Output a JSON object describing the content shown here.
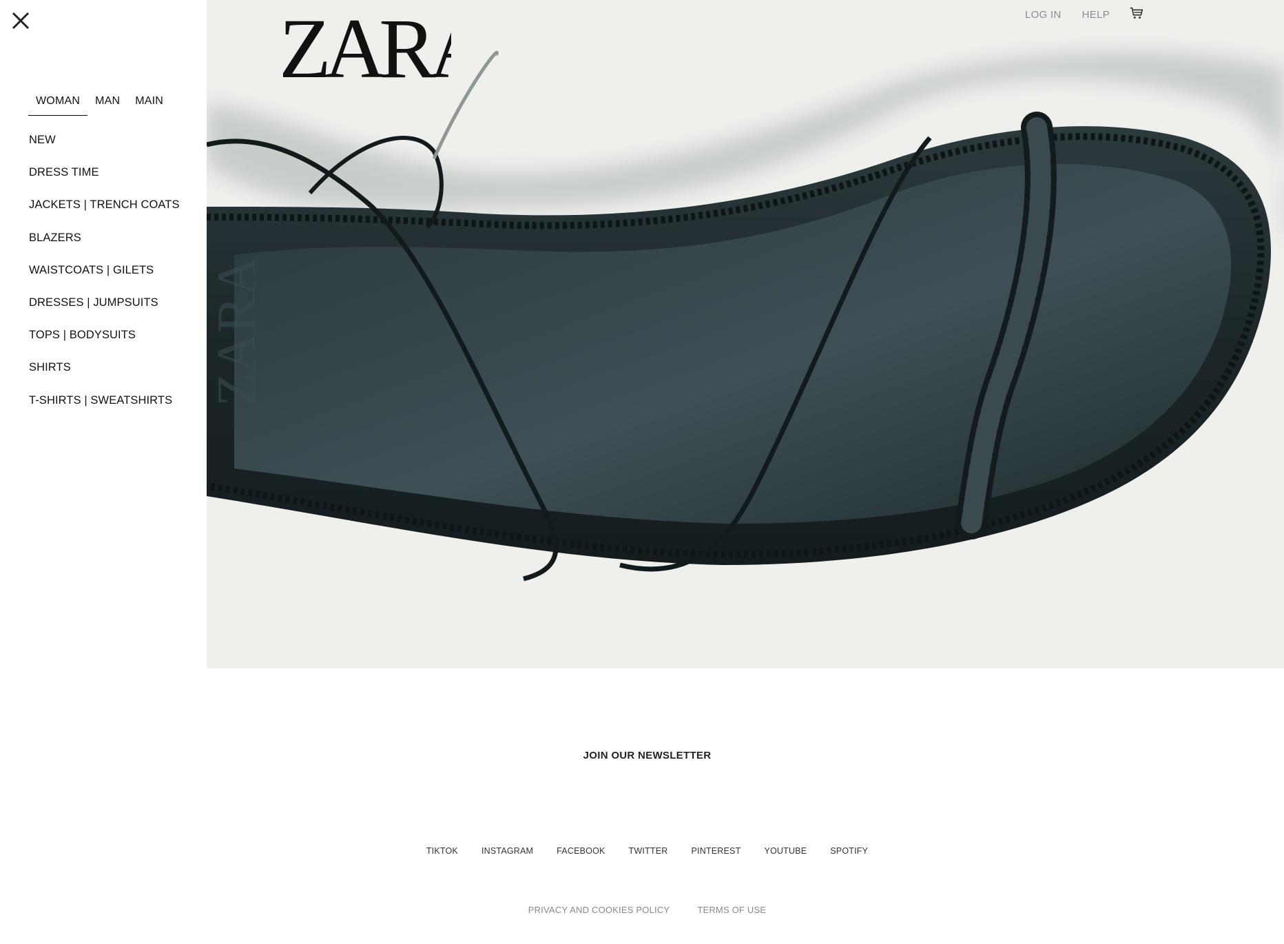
{
  "brand": {
    "logo_text": "ZARA"
  },
  "sidebar": {
    "close_icon": "close-icon",
    "tabs": [
      {
        "label": "WOMAN",
        "active": true
      },
      {
        "label": "MAN",
        "active": false
      },
      {
        "label": "MAIN",
        "active": false
      }
    ],
    "items": [
      {
        "label": "NEW"
      },
      {
        "label": "DRESS TIME"
      },
      {
        "label": "JACKETS | TRENCH COATS"
      },
      {
        "label": "BLAZERS"
      },
      {
        "label": "WAISTCOATS | GILETS"
      },
      {
        "label": "DRESSES | JUMPSUITS"
      },
      {
        "label": "TOPS | BODYSUITS"
      },
      {
        "label": "SHIRTS"
      },
      {
        "label": "T-SHIRTS | SWEATSHIRTS"
      }
    ]
  },
  "header": {
    "login_label": "LOG IN",
    "help_label": "HELP",
    "cart_icon": "shopping-cart-icon"
  },
  "hero": {
    "image": "black braided leather sandal",
    "background_color": "#efefec",
    "product_color": "#1f2c30"
  },
  "footer": {
    "newsletter_label": "JOIN OUR NEWSLETTER",
    "social": [
      "TIKTOK",
      "INSTAGRAM",
      "FACEBOOK",
      "TWITTER",
      "PINTEREST",
      "YOUTUBE",
      "SPOTIFY"
    ],
    "legal": [
      "PRIVACY AND COOKIES POLICY",
      "TERMS OF USE"
    ]
  }
}
